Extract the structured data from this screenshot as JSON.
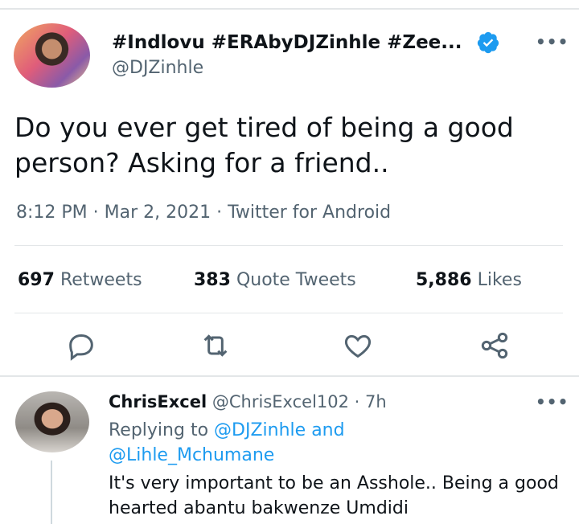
{
  "tweet": {
    "display_name": "#Indlovu #ERAbyDJZinhle #Zee...",
    "handle": "@DJZinhle",
    "text": "Do you ever get tired of being a good person? Asking for a friend..",
    "meta": "8:12 PM · Mar 2, 2021 · Twitter for Android",
    "stats": {
      "retweets_count": "697",
      "retweets_label": "Retweets",
      "quotes_count": "383",
      "quotes_label": "Quote Tweets",
      "likes_count": "5,886",
      "likes_label": "Likes"
    }
  },
  "reply": {
    "display_name": "ChrisExcel",
    "handle_time": "@ChrisExcel102 · 7h",
    "replying_prefix": "Replying to",
    "replying_user1": "@DJZinhle",
    "replying_and": "and",
    "replying_user2": "@Lihle_Mchumane",
    "text": "It's very important to be an Asshole.. Being a good hearted abantu bakwenze Umdidi"
  },
  "icons": [
    "verified-badge-icon",
    "more-icon",
    "reply-icon",
    "retweet-icon",
    "like-icon",
    "share-icon"
  ],
  "colors": {
    "accent": "#1d9bf0",
    "secondary_text": "#536471",
    "primary_text": "#0f1419"
  }
}
